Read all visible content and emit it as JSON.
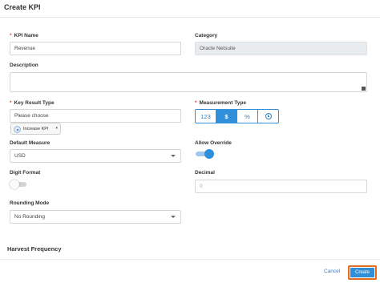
{
  "dialog": {
    "title": "Create KPI"
  },
  "form": {
    "kpi_name": {
      "label": "KPI Name",
      "required": true,
      "value": "Revenue"
    },
    "category": {
      "label": "Category",
      "value": "Oracle Netsuite"
    },
    "description": {
      "label": "Description",
      "value": ""
    },
    "key_result_type": {
      "label": "Key Result Type",
      "required": true,
      "placeholder": "Please choose",
      "chip": {
        "label": "Increase KPI",
        "icon": "target-icon",
        "caret": "▾"
      }
    },
    "measurement_type": {
      "label": "Measurement Type",
      "required": true,
      "options": [
        {
          "label": "123",
          "active": false
        },
        {
          "label": "$",
          "active": true
        },
        {
          "label": "%",
          "active": false
        },
        {
          "label": "",
          "icon": "clock-icon",
          "active": false
        }
      ]
    },
    "default_measure": {
      "label": "Default Measure",
      "value": "USD"
    },
    "allow_override": {
      "label": "Allow Override",
      "on": true
    },
    "digit_format": {
      "label": "Digit Format",
      "on": false
    },
    "decimal": {
      "label": "Decimal",
      "placeholder": "0"
    },
    "rounding_mode": {
      "label": "Rounding Mode",
      "value": "No Rounding"
    }
  },
  "sections": {
    "harvest_frequency": "Harvest Frequency"
  },
  "footer": {
    "cancel_label": "Cancel",
    "create_label": "Create"
  },
  "colors": {
    "accent": "#2f8fd8",
    "required": "#e0413a",
    "highlight": "#e36a1e"
  }
}
